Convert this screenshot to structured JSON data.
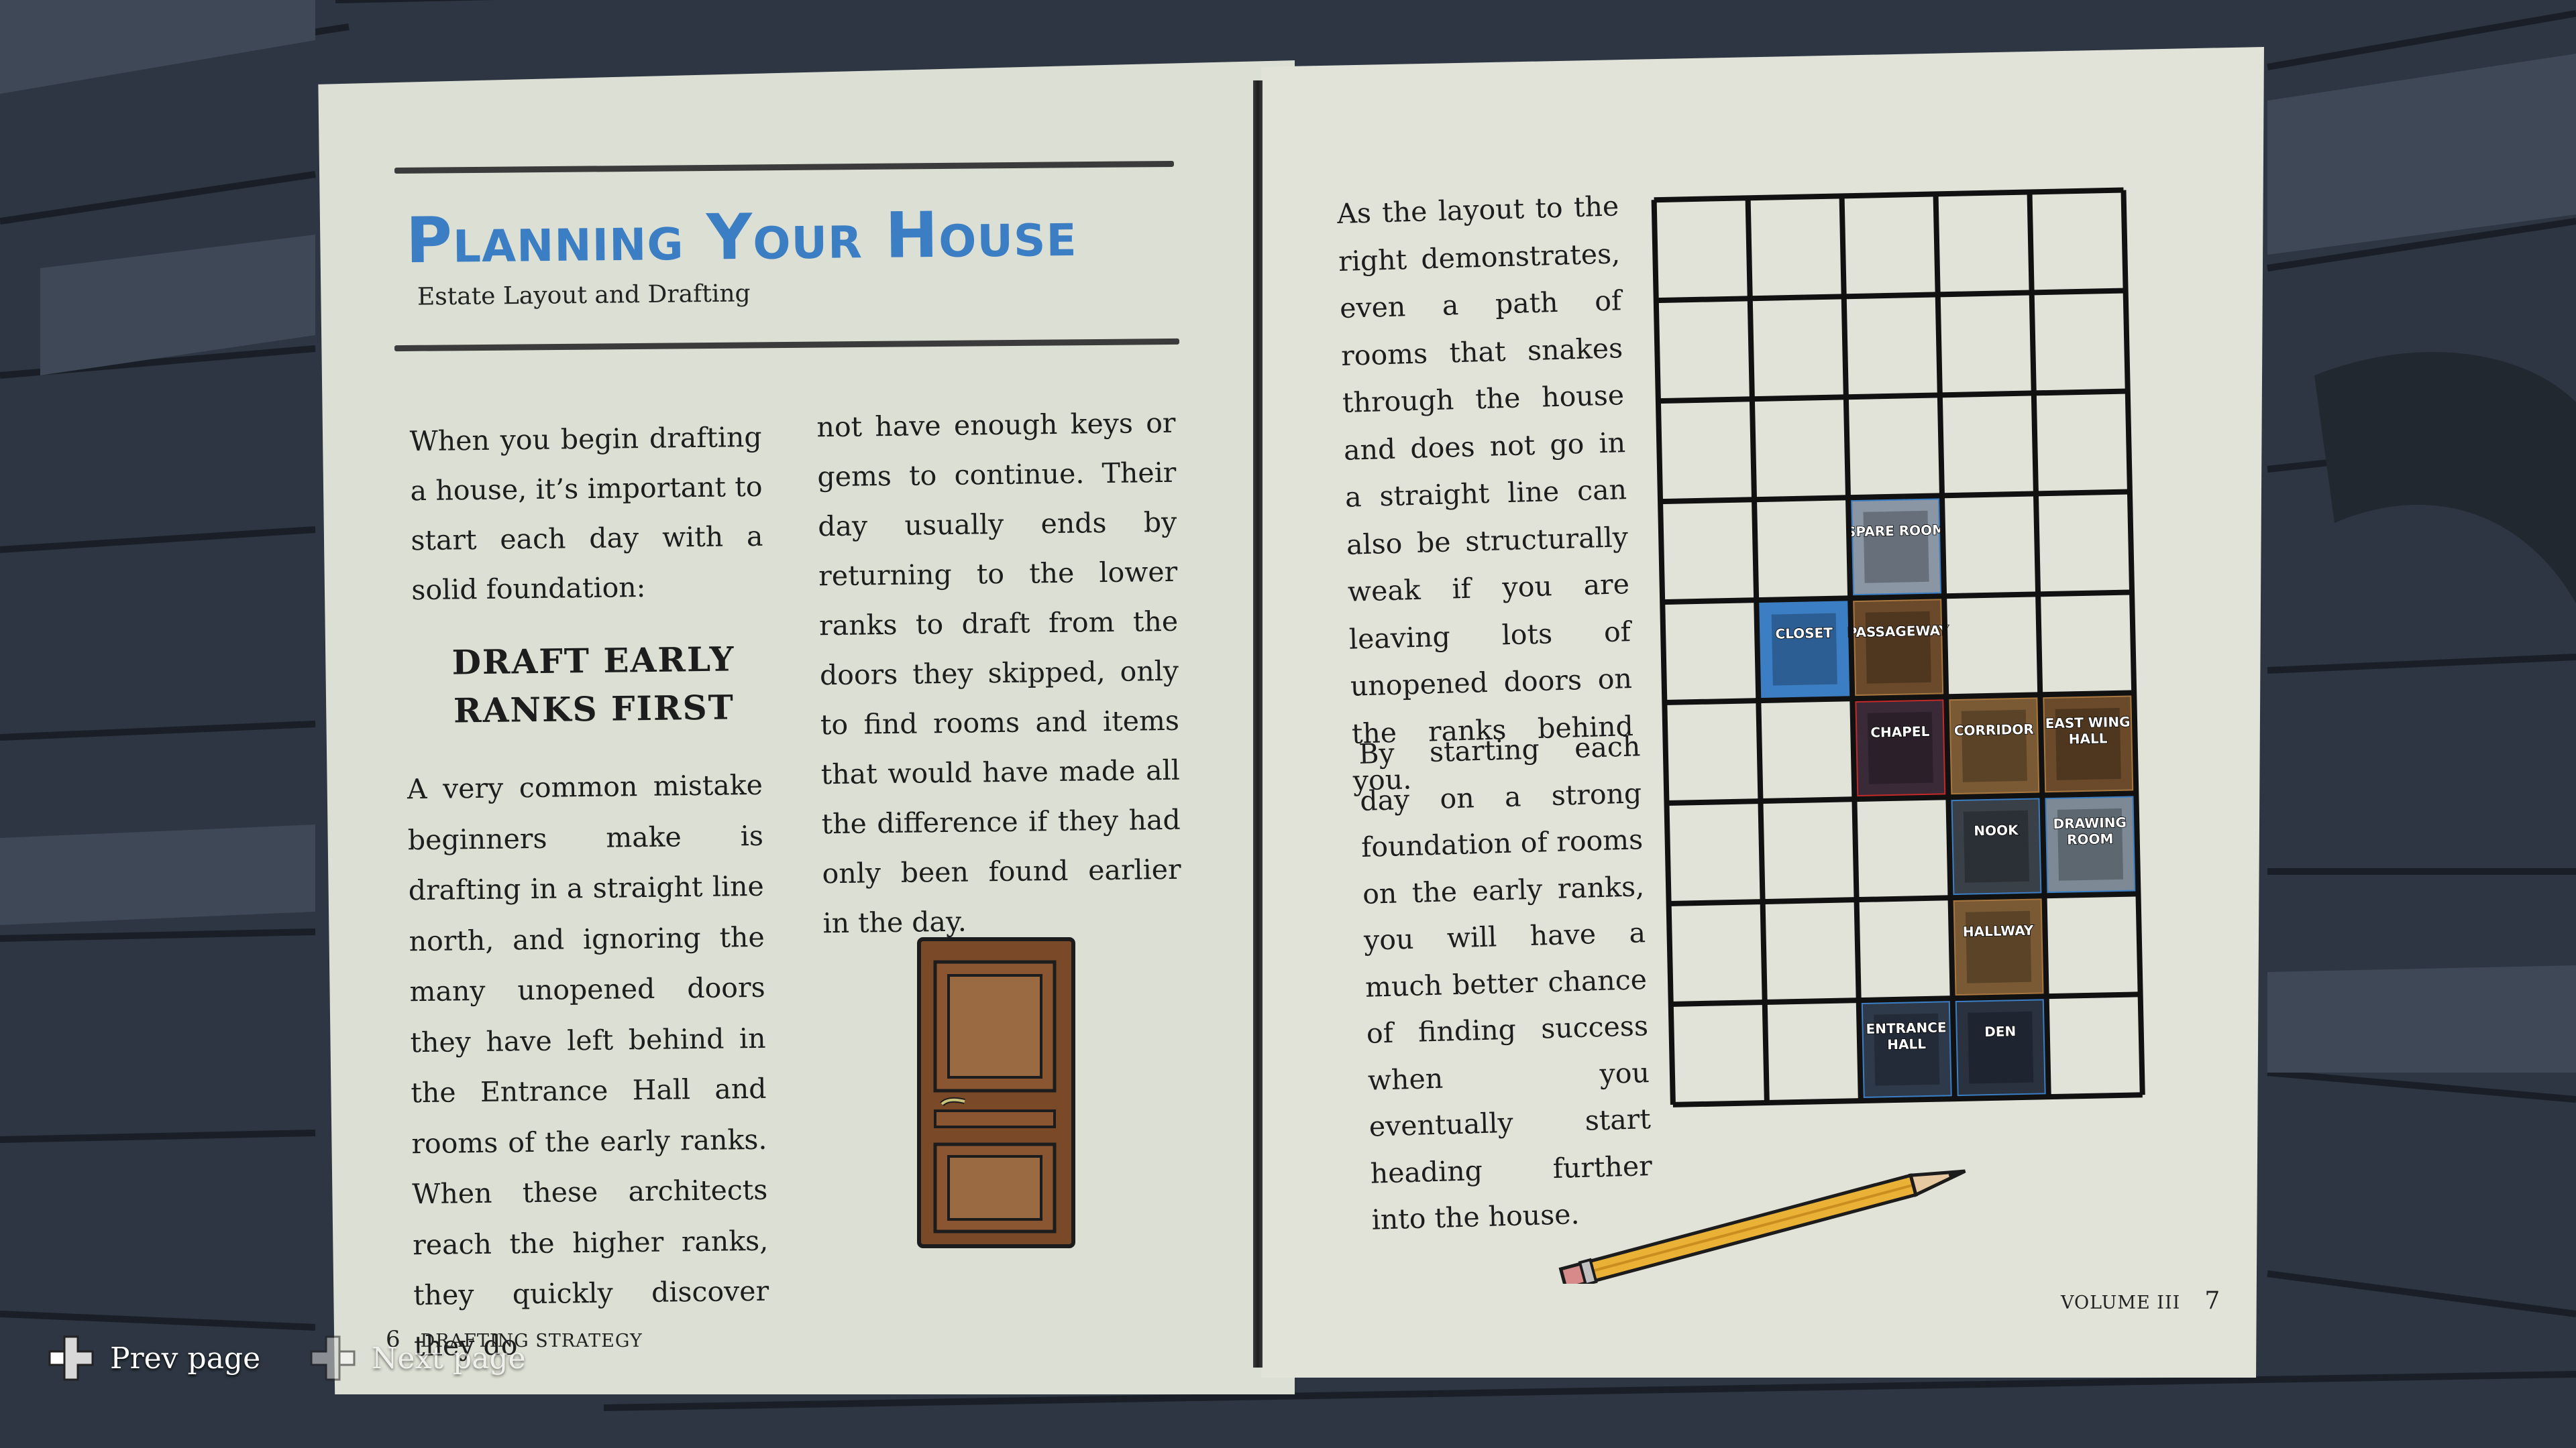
{
  "book": {
    "left_page": {
      "title": "Planning Your House",
      "subtitle": "Estate Layout and Drafting",
      "intro": "When you begin drafting a house, it’s important to start each day with a solid foundation:",
      "heading_line1": "DRAFT EARLY",
      "heading_line2": "RANKS FIRST",
      "col1_body": "A very common mistake beginners make is drafting in a straight line north, and ignoring the many unopened doors they have left behind in the Entrance Hall and rooms of the early ranks. When these architects reach the higher ranks, they quickly discover they do",
      "col2_body": "not have enough keys or gems to continue. Their day usually ends by returning to the lower ranks to draft from the doors they skipped, only to find rooms and items that would have made all the difference if they had only been found earlier in the day.",
      "page_number": "6",
      "section": "DRAFTING STRATEGY"
    },
    "right_page": {
      "para1": "As the layout to the right demonstrates, even a path of rooms that snakes through the house and does not go in a straight line can also be structurally weak if you are leaving lots of unopened doors on the ranks behind you.",
      "para2": "By starting each day on a strong foundation of rooms on the early ranks, you will have a much better chance of finding success when you eventually start heading further into the house.",
      "volume": "VOLUME III",
      "page_number": "7"
    },
    "grid": {
      "columns": 5,
      "rows": 9,
      "rooms": [
        {
          "name": "SPARE ROOM",
          "col": 2,
          "row": 3,
          "color": "#3b7ec4",
          "fill": "#8a96a3"
        },
        {
          "name": "CLOSET",
          "col": 1,
          "row": 4,
          "color": "#3b7ec4",
          "fill": "#3b7ec4"
        },
        {
          "name": "PASSAGEWAY",
          "col": 2,
          "row": 4,
          "color": "#a8773f",
          "fill": "#6a4a2a"
        },
        {
          "name": "CHAPEL",
          "col": 2,
          "row": 5,
          "color": "#c42a2a",
          "fill": "#3a2a38"
        },
        {
          "name": "CORRIDOR",
          "col": 3,
          "row": 5,
          "color": "#a8773f",
          "fill": "#7a5a34"
        },
        {
          "name": "EAST WING HALL",
          "col": 4,
          "row": 5,
          "color": "#a8773f",
          "fill": "#6a4a2a"
        },
        {
          "name": "NOOK",
          "col": 3,
          "row": 6,
          "color": "#3b7ec4",
          "fill": "#3a4048"
        },
        {
          "name": "DRAWING ROOM",
          "col": 4,
          "row": 6,
          "color": "#3b7ec4",
          "fill": "#7d8a96"
        },
        {
          "name": "HALLWAY",
          "col": 3,
          "row": 7,
          "color": "#a8773f",
          "fill": "#7a5a34"
        },
        {
          "name": "ENTRANCE HALL",
          "col": 2,
          "row": 8,
          "color": "#3b7ec4",
          "fill": "#2e3a4a"
        },
        {
          "name": "DEN",
          "col": 3,
          "row": 8,
          "color": "#3b7ec4",
          "fill": "#2a3240"
        }
      ]
    }
  },
  "controls": {
    "prev_label": "Prev page",
    "next_label": "Next page"
  },
  "colors": {
    "title": "#3b7ec4",
    "page": "#dfe1d6"
  }
}
